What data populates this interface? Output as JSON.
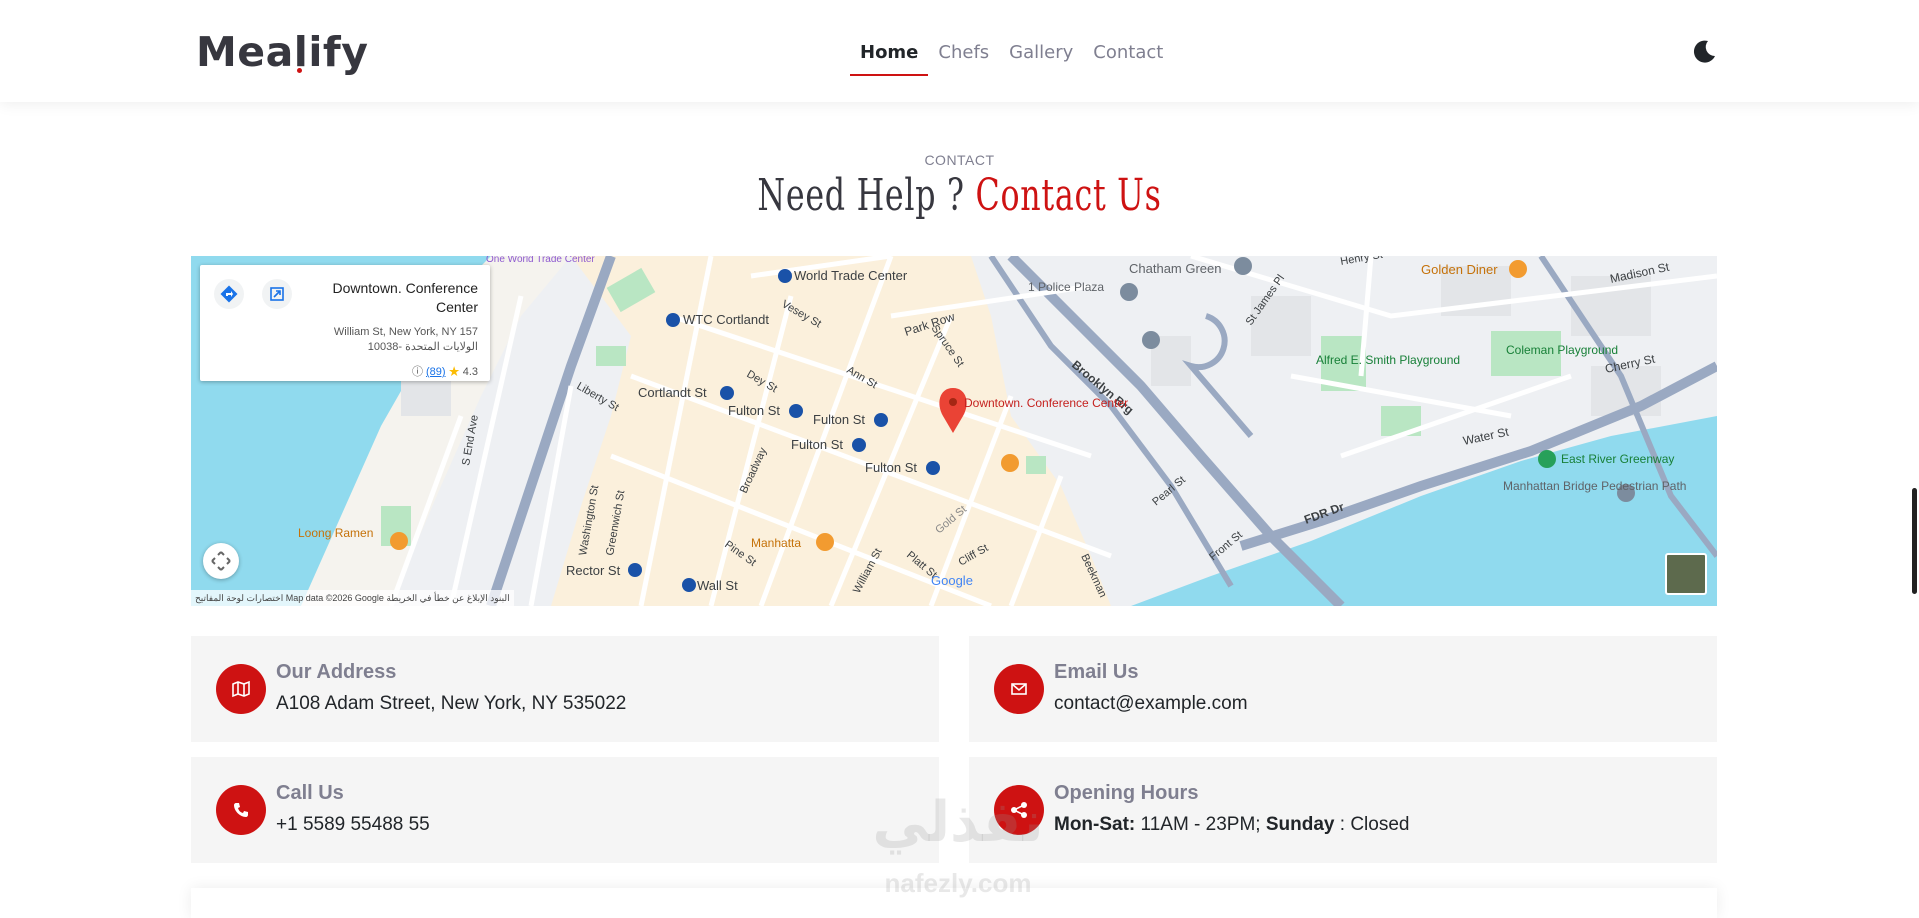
{
  "header": {
    "logo": "Mealify",
    "nav": [
      {
        "label": "Home",
        "active": true
      },
      {
        "label": "Chefs",
        "active": false
      },
      {
        "label": "Gallery",
        "active": false
      },
      {
        "label": "Contact",
        "active": false
      }
    ],
    "theme_icon": "moon-icon"
  },
  "section": {
    "subtitle": "CONTACT",
    "title_plain": "Need Help ?",
    "title_accent": "Contact Us"
  },
  "map": {
    "place_name": "Downtown. Conference Center",
    "address_line1": "William St, New York, NY 157",
    "address_line2": "10038- الولايات المتحدة",
    "rating": "4.3",
    "reviews": "(89)",
    "marker_label": "Downtown. Conference Center",
    "footer": "اختصارات لوحة المفاتيح   Map data ©2026 Google   البنود   الإبلاغ عن خطأ في الخريطة",
    "labels": [
      "World Trade Center",
      "WTC Cortlandt",
      "Cortlandt St",
      "Fulton St",
      "Fulton St",
      "Fulton St",
      "Fulton St",
      "Park Row",
      "Brooklyn Brg",
      "Chatham Green",
      "Golden Diner",
      "Madison St",
      "Alfred E. Smith Playground",
      "Coleman Playground",
      "Cherry St",
      "Water St",
      "East River Greenway",
      "Manhattan Bridge Pedestrian Path",
      "FDR Dr",
      "Loong Ramen",
      "Manhatta",
      "Rector St",
      "Wall St",
      "Pearl St",
      "Liberty St",
      "Broadway",
      "Vesey St",
      "Ann St",
      "Spruce St",
      "Gold St",
      "William St",
      "Front St",
      "Greenwich St",
      "Washington St",
      "S End Ave",
      "Dey St",
      "Pine St",
      "Cliff St",
      "Platt St",
      "Beekman",
      "Henry St",
      "St James Pl",
      "One World Trade Center",
      "1 Police Plaza"
    ],
    "brand_mark": "Google"
  },
  "contact_info": [
    {
      "label": "Our Address",
      "value": "A108 Adam Street, New York, NY 535022",
      "icon": "map-icon"
    },
    {
      "label": "Email Us",
      "value": "contact@example.com",
      "icon": "envelope-icon"
    },
    {
      "label": "Call Us",
      "value": "+1 5589 55488 55",
      "icon": "phone-icon"
    },
    {
      "label": "Opening Hours",
      "value_bold1": "Mon-Sat:",
      "value_text1": " 11AM - 23PM; ",
      "value_bold2": "Sunday",
      "value_text2": " : Closed",
      "icon": "share-icon"
    }
  ],
  "watermark": {
    "main": "نفذلي",
    "sub": "nafezly.com"
  },
  "colors": {
    "accent": "#ce1212",
    "info_bg": "#f5f5f5",
    "map_water": "#8fd3ee",
    "map_road": "#aab7c8"
  }
}
